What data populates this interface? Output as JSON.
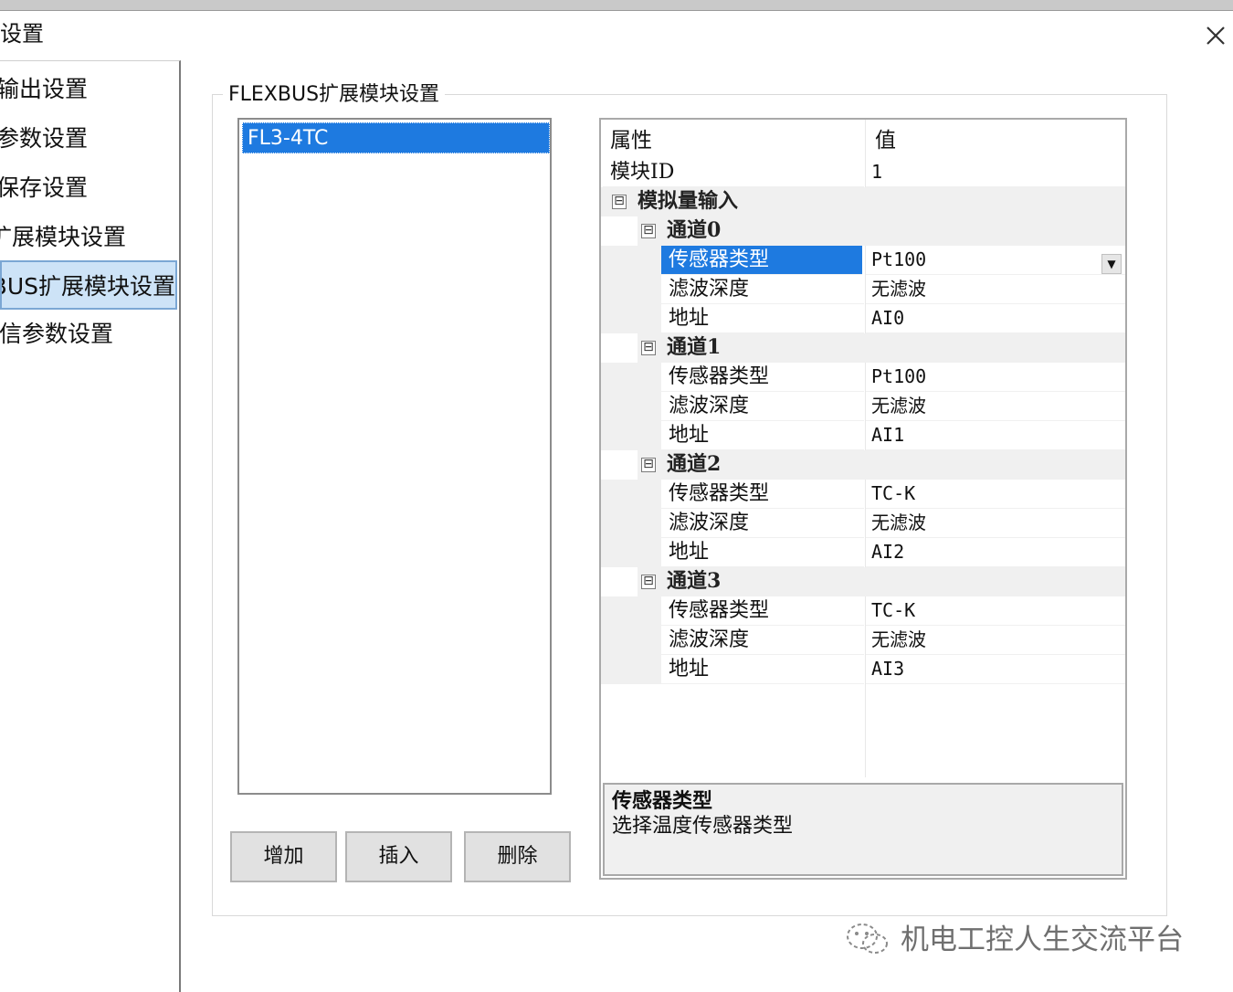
{
  "window": {
    "title": "设置"
  },
  "nav": {
    "items": [
      {
        "label": "输出设置"
      },
      {
        "label": "参数设置"
      },
      {
        "label": "保存设置"
      },
      {
        "label": "扩展模块设置"
      },
      {
        "label": "FLEXBUS扩展模块设置"
      },
      {
        "label": "通信参数设置"
      }
    ],
    "active_index": 4
  },
  "group": {
    "title": "FLEXBUS扩展模块设置"
  },
  "module_list": {
    "items": [
      "FL3-4TC"
    ],
    "selected": "FL3-4TC"
  },
  "buttons": {
    "add": "增加",
    "insert": "插入",
    "delete": "删除"
  },
  "property_grid": {
    "header": {
      "property": "属性",
      "value": "值"
    },
    "module_id": {
      "name": "模块ID",
      "value": "1"
    },
    "category": {
      "label": "模拟量输入",
      "toggle": "⊟"
    },
    "channels": [
      {
        "label": "通道0",
        "toggle": "⊟",
        "rows": [
          {
            "name": "传感器类型",
            "value": "Pt100"
          },
          {
            "name": "滤波深度",
            "value": "无滤波"
          },
          {
            "name": "地址",
            "value": "AI0"
          }
        ]
      },
      {
        "label": "通道1",
        "toggle": "⊟",
        "rows": [
          {
            "name": "传感器类型",
            "value": "Pt100"
          },
          {
            "name": "滤波深度",
            "value": "无滤波"
          },
          {
            "name": "地址",
            "value": "AI1"
          }
        ]
      },
      {
        "label": "通道2",
        "toggle": "⊟",
        "rows": [
          {
            "name": "传感器类型",
            "value": "TC-K"
          },
          {
            "name": "滤波深度",
            "value": "无滤波"
          },
          {
            "name": "地址",
            "value": "AI2"
          }
        ]
      },
      {
        "label": "通道3",
        "toggle": "⊟",
        "rows": [
          {
            "name": "传感器类型",
            "value": "TC-K"
          },
          {
            "name": "滤波深度",
            "value": "无滤波"
          },
          {
            "name": "地址",
            "value": "AI3"
          }
        ]
      }
    ],
    "selected_property": "传感器类型",
    "help": {
      "title": "传感器类型",
      "description": "选择温度传感器类型"
    }
  },
  "watermark": {
    "text": "机电工控人生交流平台"
  },
  "icons": {
    "close": "close-icon",
    "dropdown": "chevron-down-icon",
    "collapse": "minus-box-icon",
    "watermark": "wechat-icon"
  },
  "colors": {
    "selection": "#1e7ae0",
    "nav_active": "#cde3f7",
    "button_face": "#e1e1e1"
  }
}
